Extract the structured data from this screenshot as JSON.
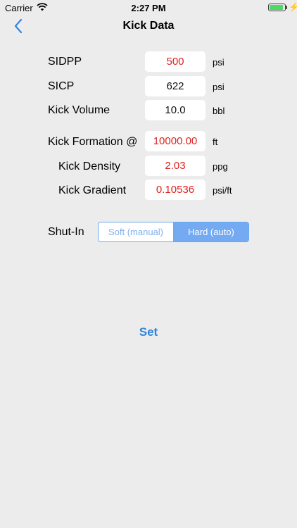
{
  "status_bar": {
    "carrier": "Carrier",
    "time": "2:27 PM",
    "battery_level_percent": 90,
    "icons": [
      "wifi-icon",
      "battery-icon",
      "charging-bolt-icon"
    ]
  },
  "nav": {
    "title": "Kick Data",
    "back_icon": "chevron-left-icon"
  },
  "rows": [
    {
      "label": "SIDPP",
      "value": "500",
      "unit": "psi",
      "value_color": "#e0201b"
    },
    {
      "label": "SICP",
      "value": "622",
      "unit": "psi",
      "value_color": "#111111"
    },
    {
      "label": "Kick Volume",
      "value": "10.0",
      "unit": "bbl",
      "value_color": "#111111"
    },
    {
      "label": "Kick Formation @",
      "value": "10000.00",
      "unit": "ft",
      "value_color": "#e0201b"
    },
    {
      "label": "Kick Density",
      "value": "2.03",
      "unit": "ppg",
      "value_color": "#e0201b"
    },
    {
      "label": "Kick Gradient",
      "value": "0.10536",
      "unit": "psi/ft",
      "value_color": "#e0201b"
    }
  ],
  "shut_in": {
    "label": "Shut-In",
    "options": [
      "Soft (manual)",
      "Hard (auto)"
    ],
    "selected": "Hard (auto)"
  },
  "set_button": "Set",
  "colors": {
    "background": "#ececec",
    "accent": "#2f86df",
    "segment_selected": "#73aaf2",
    "warning_value": "#e0201b"
  }
}
